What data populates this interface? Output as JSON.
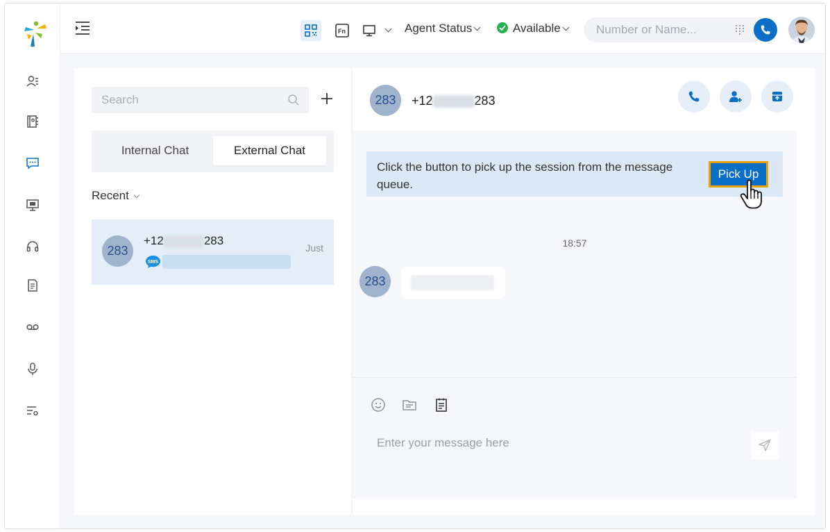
{
  "colors": {
    "accent": "#0b6fc8",
    "available": "#29b04e",
    "highlight": "#f0a202"
  },
  "nav": {
    "items": [
      {
        "name": "nav-contacts",
        "icon": "contacts-icon"
      },
      {
        "name": "nav-phonebook",
        "icon": "phonebook-icon"
      },
      {
        "name": "nav-chat",
        "icon": "chat-icon",
        "active": true
      },
      {
        "name": "nav-presentation",
        "icon": "monitor-icon"
      },
      {
        "name": "nav-queue",
        "icon": "headset-icon"
      },
      {
        "name": "nav-notes",
        "icon": "document-icon"
      },
      {
        "name": "nav-voicemail",
        "icon": "voicemail-icon"
      },
      {
        "name": "nav-recording",
        "icon": "microphone-icon"
      },
      {
        "name": "nav-settings",
        "icon": "list-settings-icon"
      }
    ]
  },
  "topbar": {
    "agent_status_label": "Agent Status",
    "availability": "Available",
    "dial_placeholder": "Number or Name..."
  },
  "sidebar": {
    "search_placeholder": "Search",
    "tabs": [
      {
        "label": "Internal Chat",
        "active": false
      },
      {
        "label": "External Chat",
        "active": true
      }
    ],
    "recent_label": "Recent",
    "conversations": [
      {
        "avatar": "283",
        "number_prefix": "+12",
        "number_suffix": "283",
        "time": "Just",
        "channel": "SMS"
      }
    ]
  },
  "chat": {
    "header": {
      "avatar": "283",
      "number_prefix": "+12",
      "number_suffix": "283"
    },
    "notice": "Click the button to pick up the session from the message queue.",
    "pickup_label": "Pick Up",
    "timestamp": "18:57",
    "message_avatar": "283",
    "composer_placeholder": "Enter your message here"
  }
}
